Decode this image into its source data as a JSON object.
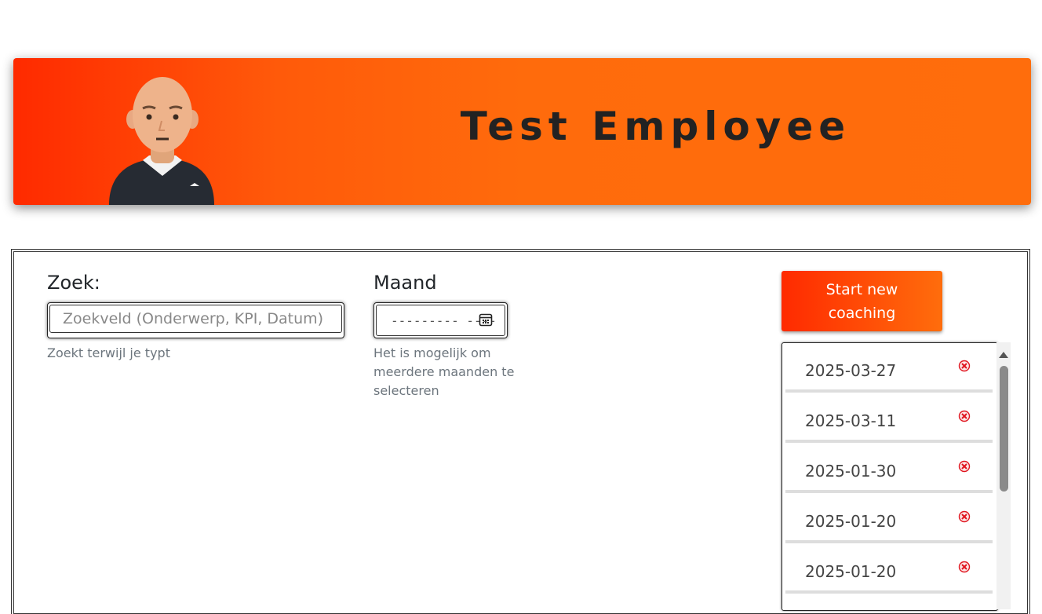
{
  "header": {
    "title": "Test Employee",
    "avatar_icon": "bald-man-avatar-icon"
  },
  "search": {
    "label": "Zoek:",
    "placeholder": "Zoekveld (Onderwerp, KPI, Datum)",
    "hint": "Zoekt terwijl je typt"
  },
  "month": {
    "label": "Maand",
    "value_display": "--------- ----",
    "hint": "Het is mogelijk om meerdere maanden te selecteren",
    "icon": "calendar-icon"
  },
  "actions": {
    "start_label": "Start new coaching"
  },
  "coachings": [
    {
      "date": "2025-03-27"
    },
    {
      "date": "2025-03-11"
    },
    {
      "date": "2025-01-30"
    },
    {
      "date": "2025-01-20"
    },
    {
      "date": "2025-01-20"
    }
  ],
  "colors": {
    "brand_start": "#ff2a00",
    "brand_end": "#ff6d0c",
    "delete_red": "#e0141e"
  }
}
